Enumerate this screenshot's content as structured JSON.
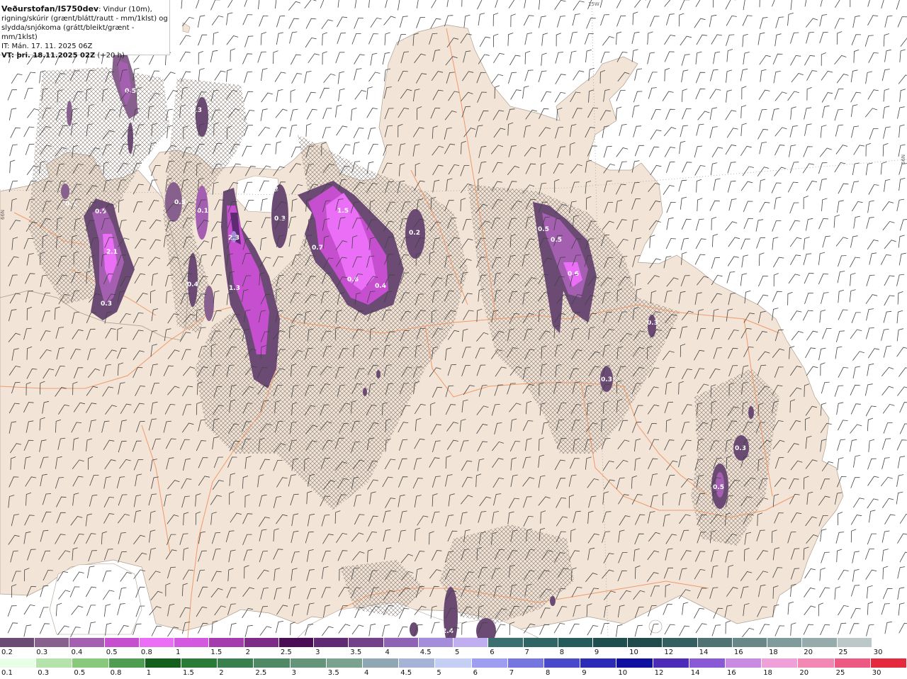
{
  "header": {
    "source": "Veðurstofan/IS750dev",
    "description_1": ": Vindur (10m),",
    "description_2": "rigning/skúrir (grænt/blátt/rautt - mm/1klst) og",
    "description_3": "slydda/snjókoma (grátt/bleikt/grænt - mm/1klst)",
    "issue_time": "IT: Mán. 17. 11. 2025 06Z",
    "valid_time": "VT: þri. 18.11.2025 02Z",
    "lead": " (+20 h)"
  },
  "grid_labels": {
    "lon": "15W",
    "lat_left": "66N",
    "lat_right": "66N"
  },
  "precip_values": [
    {
      "label": "0.5"
    },
    {
      "label": "0.1"
    },
    {
      "label": "0.5"
    },
    {
      "label": "2.1"
    },
    {
      "label": "0.3"
    },
    {
      "label": "0.5"
    },
    {
      "label": "0.1"
    },
    {
      "label": "0.4"
    },
    {
      "label": "0.3"
    },
    {
      "label": "0.3"
    },
    {
      "label": "2.3"
    },
    {
      "label": "1.3"
    },
    {
      "label": "0.3"
    },
    {
      "label": "1.5"
    },
    {
      "label": "0.7"
    },
    {
      "label": "0.6"
    },
    {
      "label": "0.4"
    },
    {
      "label": "0.2"
    },
    {
      "label": "0.5"
    },
    {
      "label": "0.5"
    },
    {
      "label": "0.6"
    },
    {
      "label": "0.3"
    },
    {
      "label": "0.3"
    },
    {
      "label": "0.3"
    },
    {
      "label": "0.5"
    },
    {
      "label": "2.4"
    }
  ],
  "snow_scale": {
    "labels": [
      "0.2",
      "0.3",
      "0.4",
      "0.5",
      "0.8",
      "1",
      "1.5",
      "2",
      "2.5",
      "3",
      "3.5",
      "4",
      "4.5",
      "5",
      "6",
      "7",
      "8",
      "9",
      "10",
      "12",
      "14",
      "16",
      "18",
      "20",
      "25",
      "30"
    ],
    "colors": [
      "#6b4a74",
      "#87608d",
      "#a45fb0",
      "#c64fd0",
      "#ea6ef6",
      "#d35ae0",
      "#a43cb0",
      "#7d2a88",
      "#4a0d55",
      "#5f2a73",
      "#73408a",
      "#8e62b4",
      "#a48edb",
      "#bfaef0",
      "#396f6e",
      "#2f6564",
      "#255c5b",
      "#1e4f4e",
      "#1f4b4c",
      "#345f60",
      "#4f7373",
      "#6a8787",
      "#7f9b9b",
      "#96abab",
      "#bcc7c7",
      "#ffffff"
    ]
  },
  "rain_scale": {
    "labels": [
      "0.1",
      "0.3",
      "0.5",
      "0.8",
      "1",
      "1.5",
      "2",
      "2.5",
      "3",
      "3.5",
      "4",
      "4.5",
      "5",
      "6",
      "7",
      "8",
      "9",
      "10",
      "12",
      "14",
      "16",
      "18",
      "20",
      "25",
      "30"
    ],
    "colors": [
      "#e7ffe4",
      "#b6e3ac",
      "#88c97c",
      "#4f9d50",
      "#145f1c",
      "#2a7b38",
      "#3a7f4e",
      "#4f8a65",
      "#64957b",
      "#7ba290",
      "#8fa6b4",
      "#a4b3d6",
      "#c5cff3",
      "#9d9ef0",
      "#7676e0",
      "#4949cc",
      "#2b2bb8",
      "#1010a0",
      "#4b2bb8",
      "#8a5ad6",
      "#c98ae2",
      "#f0a0d8",
      "#f288b4",
      "#ec5a84",
      "#e42a3c"
    ]
  }
}
